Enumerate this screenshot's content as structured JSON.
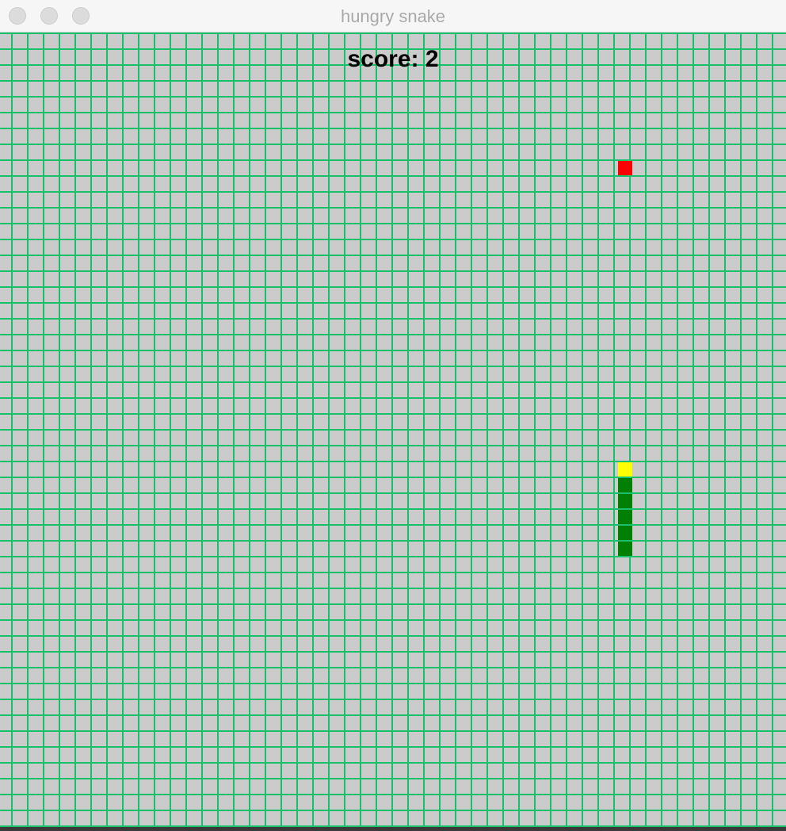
{
  "window": {
    "title": "hungry snake"
  },
  "game": {
    "score_text": "score: 2",
    "score": 2,
    "snake": {
      "head_color": "#ffff00",
      "body_color": "#008000",
      "cells": [
        {
          "col": 39,
          "row": 27,
          "part": "head"
        },
        {
          "col": 39,
          "row": 28,
          "part": "body"
        },
        {
          "col": 39,
          "row": 29,
          "part": "body"
        },
        {
          "col": 39,
          "row": 30,
          "part": "body"
        },
        {
          "col": 39,
          "row": 31,
          "part": "body"
        },
        {
          "col": 39,
          "row": 32,
          "part": "body"
        }
      ]
    },
    "food": {
      "col": 39,
      "row": 8,
      "color": "#ff0000"
    },
    "grid": {
      "line_color": "#19c06b",
      "background_color": "#cbcbcb"
    }
  }
}
